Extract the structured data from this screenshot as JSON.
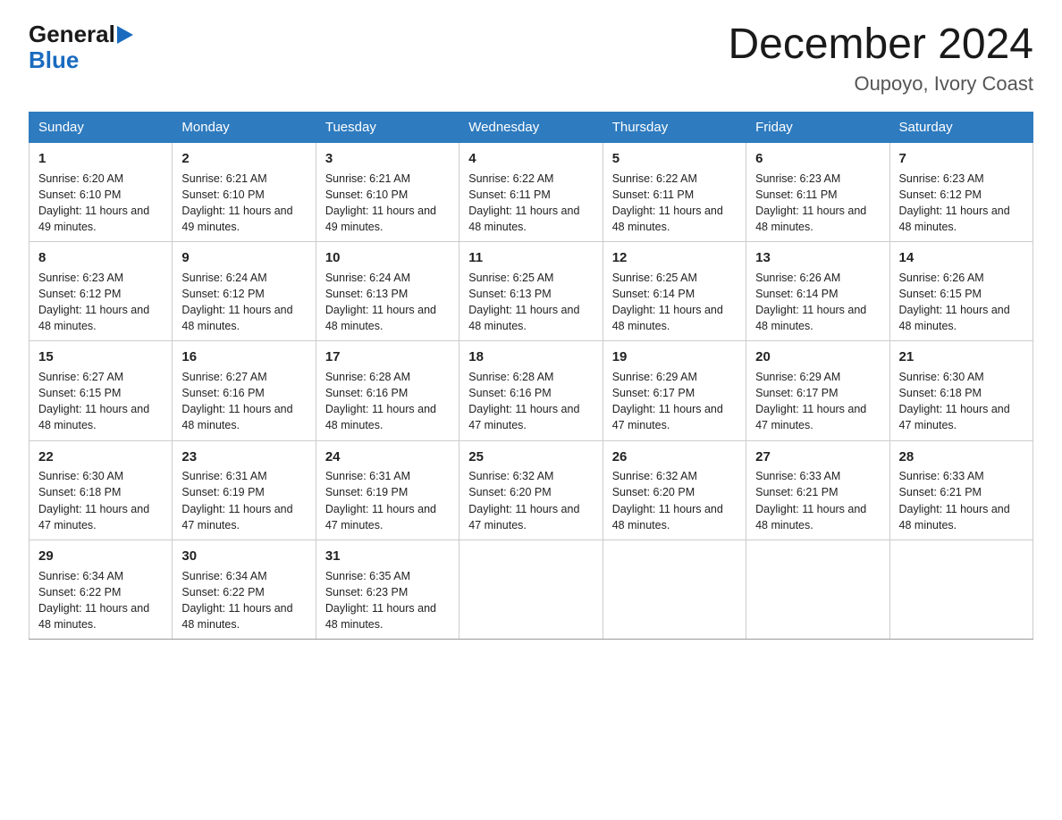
{
  "logo": {
    "general": "General",
    "blue": "Blue",
    "arrow_unicode": "▶"
  },
  "title": {
    "month_year": "December 2024",
    "location": "Oupoyo, Ivory Coast"
  },
  "weekdays": [
    "Sunday",
    "Monday",
    "Tuesday",
    "Wednesday",
    "Thursday",
    "Friday",
    "Saturday"
  ],
  "weeks": [
    [
      {
        "day": "1",
        "sunrise": "6:20 AM",
        "sunset": "6:10 PM",
        "daylight": "11 hours and 49 minutes."
      },
      {
        "day": "2",
        "sunrise": "6:21 AM",
        "sunset": "6:10 PM",
        "daylight": "11 hours and 49 minutes."
      },
      {
        "day": "3",
        "sunrise": "6:21 AM",
        "sunset": "6:10 PM",
        "daylight": "11 hours and 49 minutes."
      },
      {
        "day": "4",
        "sunrise": "6:22 AM",
        "sunset": "6:11 PM",
        "daylight": "11 hours and 48 minutes."
      },
      {
        "day": "5",
        "sunrise": "6:22 AM",
        "sunset": "6:11 PM",
        "daylight": "11 hours and 48 minutes."
      },
      {
        "day": "6",
        "sunrise": "6:23 AM",
        "sunset": "6:11 PM",
        "daylight": "11 hours and 48 minutes."
      },
      {
        "day": "7",
        "sunrise": "6:23 AM",
        "sunset": "6:12 PM",
        "daylight": "11 hours and 48 minutes."
      }
    ],
    [
      {
        "day": "8",
        "sunrise": "6:23 AM",
        "sunset": "6:12 PM",
        "daylight": "11 hours and 48 minutes."
      },
      {
        "day": "9",
        "sunrise": "6:24 AM",
        "sunset": "6:12 PM",
        "daylight": "11 hours and 48 minutes."
      },
      {
        "day": "10",
        "sunrise": "6:24 AM",
        "sunset": "6:13 PM",
        "daylight": "11 hours and 48 minutes."
      },
      {
        "day": "11",
        "sunrise": "6:25 AM",
        "sunset": "6:13 PM",
        "daylight": "11 hours and 48 minutes."
      },
      {
        "day": "12",
        "sunrise": "6:25 AM",
        "sunset": "6:14 PM",
        "daylight": "11 hours and 48 minutes."
      },
      {
        "day": "13",
        "sunrise": "6:26 AM",
        "sunset": "6:14 PM",
        "daylight": "11 hours and 48 minutes."
      },
      {
        "day": "14",
        "sunrise": "6:26 AM",
        "sunset": "6:15 PM",
        "daylight": "11 hours and 48 minutes."
      }
    ],
    [
      {
        "day": "15",
        "sunrise": "6:27 AM",
        "sunset": "6:15 PM",
        "daylight": "11 hours and 48 minutes."
      },
      {
        "day": "16",
        "sunrise": "6:27 AM",
        "sunset": "6:16 PM",
        "daylight": "11 hours and 48 minutes."
      },
      {
        "day": "17",
        "sunrise": "6:28 AM",
        "sunset": "6:16 PM",
        "daylight": "11 hours and 48 minutes."
      },
      {
        "day": "18",
        "sunrise": "6:28 AM",
        "sunset": "6:16 PM",
        "daylight": "11 hours and 47 minutes."
      },
      {
        "day": "19",
        "sunrise": "6:29 AM",
        "sunset": "6:17 PM",
        "daylight": "11 hours and 47 minutes."
      },
      {
        "day": "20",
        "sunrise": "6:29 AM",
        "sunset": "6:17 PM",
        "daylight": "11 hours and 47 minutes."
      },
      {
        "day": "21",
        "sunrise": "6:30 AM",
        "sunset": "6:18 PM",
        "daylight": "11 hours and 47 minutes."
      }
    ],
    [
      {
        "day": "22",
        "sunrise": "6:30 AM",
        "sunset": "6:18 PM",
        "daylight": "11 hours and 47 minutes."
      },
      {
        "day": "23",
        "sunrise": "6:31 AM",
        "sunset": "6:19 PM",
        "daylight": "11 hours and 47 minutes."
      },
      {
        "day": "24",
        "sunrise": "6:31 AM",
        "sunset": "6:19 PM",
        "daylight": "11 hours and 47 minutes."
      },
      {
        "day": "25",
        "sunrise": "6:32 AM",
        "sunset": "6:20 PM",
        "daylight": "11 hours and 47 minutes."
      },
      {
        "day": "26",
        "sunrise": "6:32 AM",
        "sunset": "6:20 PM",
        "daylight": "11 hours and 48 minutes."
      },
      {
        "day": "27",
        "sunrise": "6:33 AM",
        "sunset": "6:21 PM",
        "daylight": "11 hours and 48 minutes."
      },
      {
        "day": "28",
        "sunrise": "6:33 AM",
        "sunset": "6:21 PM",
        "daylight": "11 hours and 48 minutes."
      }
    ],
    [
      {
        "day": "29",
        "sunrise": "6:34 AM",
        "sunset": "6:22 PM",
        "daylight": "11 hours and 48 minutes."
      },
      {
        "day": "30",
        "sunrise": "6:34 AM",
        "sunset": "6:22 PM",
        "daylight": "11 hours and 48 minutes."
      },
      {
        "day": "31",
        "sunrise": "6:35 AM",
        "sunset": "6:23 PM",
        "daylight": "11 hours and 48 minutes."
      },
      null,
      null,
      null,
      null
    ]
  ]
}
